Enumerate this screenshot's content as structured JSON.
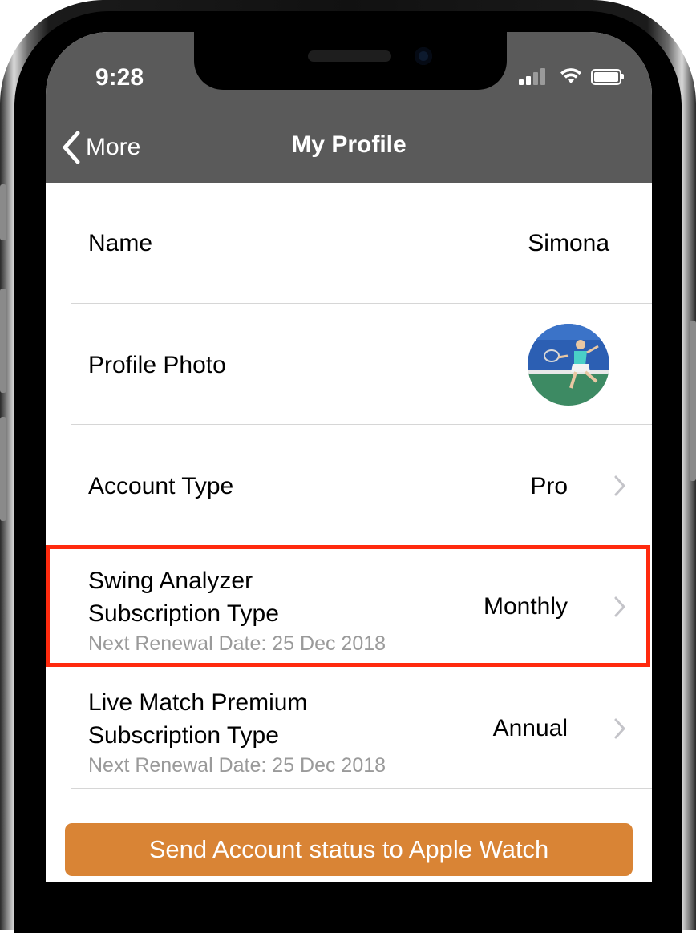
{
  "status_bar": {
    "time": "9:28"
  },
  "nav": {
    "back_label": "More",
    "title": "My Profile"
  },
  "rows": {
    "name": {
      "label": "Name",
      "value": "Simona"
    },
    "photo": {
      "label": "Profile Photo"
    },
    "account": {
      "label": "Account Type",
      "value": "Pro"
    },
    "swing": {
      "label_line1": "Swing Analyzer",
      "label_line2": "Subscription Type",
      "value": "Monthly",
      "sub": "Next Renewal Date: 25 Dec 2018"
    },
    "live": {
      "label_line1": "Live Match Premium",
      "label_line2": "Subscription Type",
      "value": "Annual",
      "sub": "Next Renewal Date: 25 Dec 2018"
    }
  },
  "action_button": {
    "label": "Send Account status to Apple Watch"
  },
  "colors": {
    "header": "#5a5a5a",
    "accent_button": "#d98435",
    "highlight_border": "#ff2a0e",
    "secondary_text": "#9a9a9a"
  }
}
